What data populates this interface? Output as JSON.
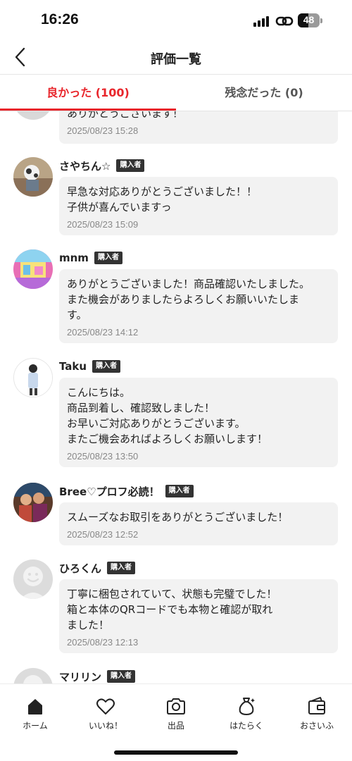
{
  "status_bar": {
    "time": "16:26",
    "battery": "48"
  },
  "header": {
    "title": "評価一覧"
  },
  "tabs": [
    {
      "label": "良かった (100)",
      "active": true
    },
    {
      "label": "残念だった (0)",
      "active": false
    }
  ],
  "colors": {
    "accent": "#e8252b",
    "badge": "#333333",
    "bubble": "#f2f2f2"
  },
  "reviews": [
    {
      "name": "",
      "badge": "",
      "message": "ありがとうございます！",
      "date": "2025/08/23 15:28"
    },
    {
      "name": "さやちん☆",
      "badge": "購入者",
      "message": "早急な対応ありがとうございました！！\n子供が喜んでいますっ",
      "date": "2025/08/23 15:09"
    },
    {
      "name": "mnm",
      "badge": "購入者",
      "message": "ありがとうございました！商品確認いたしました。\nまた機会がありましたらよろしくお願いいたしま\nす。",
      "date": "2025/08/23 14:12"
    },
    {
      "name": "Taku",
      "badge": "購入者",
      "message": "こんにちは。\n商品到着し、確認致しました！\nお早いご対応ありがとうございます。\nまたご機会あればよろしくお願いします！",
      "date": "2025/08/23 13:50"
    },
    {
      "name": "Bree♡プロフ必読！",
      "badge": "購入者",
      "message": "スムーズなお取引をありがとうございました！",
      "date": "2025/08/23 12:52"
    },
    {
      "name": "ひろくん",
      "badge": "購入者",
      "message": "丁寧に梱包されていて、状態も完璧でした！\n箱と本体のQRコードでも本物と確認が取れ\nました！",
      "date": "2025/08/23 12:13"
    },
    {
      "name": "マリリン",
      "badge": "購入者",
      "message": "",
      "date": ""
    }
  ],
  "tabbar": [
    {
      "label": "ホーム",
      "icon": "home-icon"
    },
    {
      "label": "いいね！",
      "icon": "heart-icon"
    },
    {
      "label": "出品",
      "icon": "camera-icon"
    },
    {
      "label": "はたらく",
      "icon": "money-bag-icon"
    },
    {
      "label": "おさいふ",
      "icon": "wallet-icon"
    }
  ]
}
